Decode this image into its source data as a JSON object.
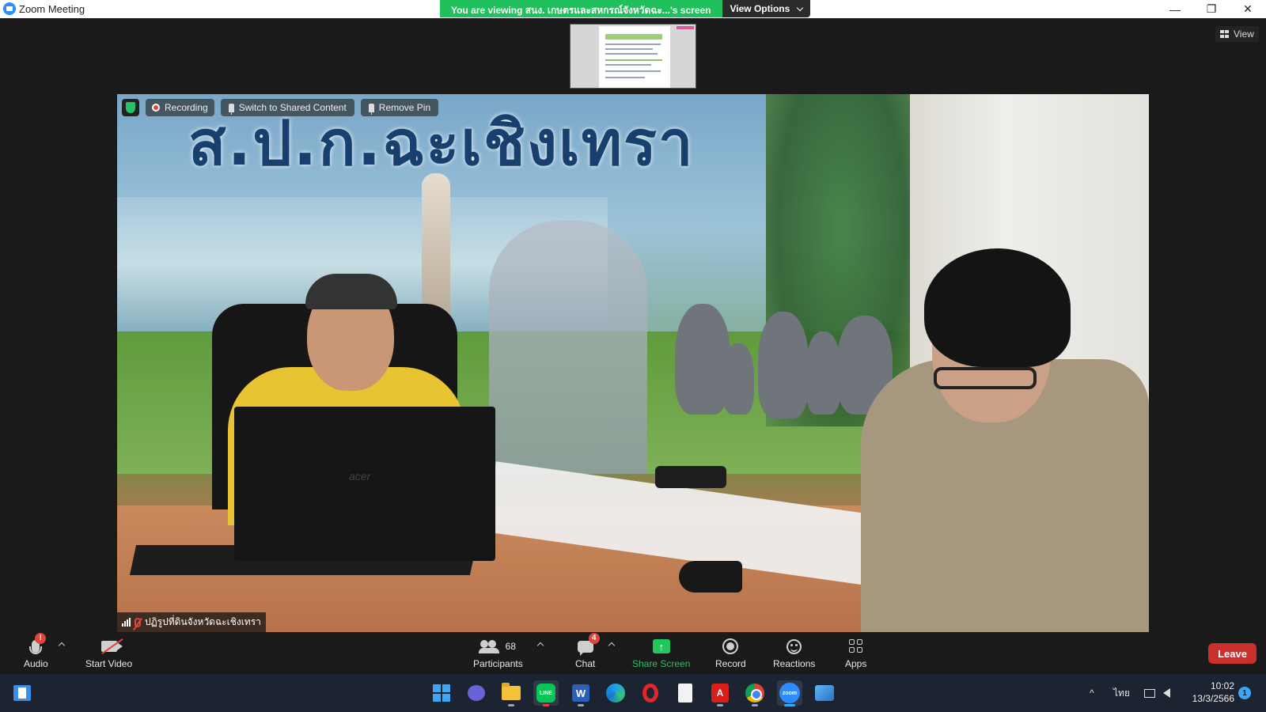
{
  "window": {
    "title": "Zoom Meeting",
    "minimize_glyph": "—",
    "restore_glyph": "❐",
    "close_glyph": "✕"
  },
  "share_banner": {
    "viewing_text": "You are viewing สนง. เกษตรและสหกรณ์จังหวัดฉะ...'s screen",
    "view_options_label": "View Options"
  },
  "view_button": {
    "label": "View"
  },
  "video": {
    "banner_text": "ส.ป.ก.ฉะเชิงเทรา",
    "laptop_brand": "acer",
    "recording_label": "Recording",
    "switch_label": "Switch to Shared Content",
    "remove_pin_label": "Remove Pin",
    "participant_name": "ปฏิรูปที่ดินจังหวัดฉะเชิงเทรา"
  },
  "controls": {
    "audio_label": "Audio",
    "audio_badge": "!",
    "start_video_label": "Start Video",
    "participants_label": "Participants",
    "participants_count": "68",
    "chat_label": "Chat",
    "chat_badge": "4",
    "share_screen_label": "Share Screen",
    "share_screen_glyph": "↑",
    "record_label": "Record",
    "reactions_label": "Reactions",
    "apps_label": "Apps",
    "leave_label": "Leave"
  },
  "taskbar": {
    "apps": [
      "widgets",
      "windows-start",
      "teams-chat",
      "file-explorer",
      "line",
      "word",
      "edge",
      "opera",
      "file",
      "acrobat",
      "chrome",
      "zoom",
      "photos"
    ],
    "line_text": "LINE",
    "word_text": "W",
    "acrobat_text": "A",
    "zoom_text": "zoom",
    "tray_chevron": "^",
    "language": "ไทย",
    "clock_time": "10:02",
    "clock_date": "13/3/2566",
    "notification_count": "1"
  },
  "colors": {
    "share_green": "#20c05c",
    "leave_red": "#c9302c",
    "zoom_blue": "#2d8cff",
    "taskbar_bg": "#1c2331"
  }
}
